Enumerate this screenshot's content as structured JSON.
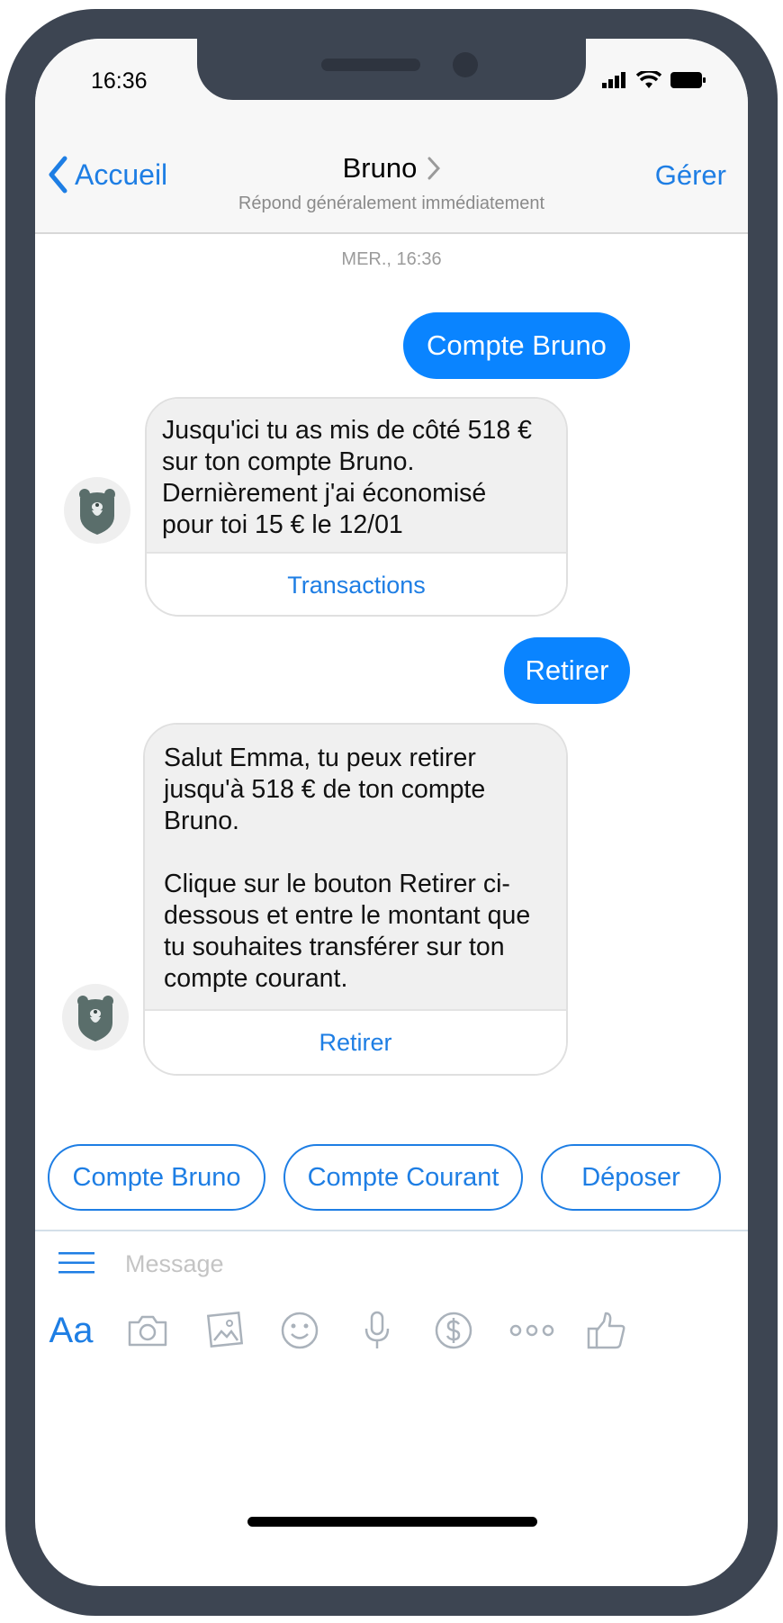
{
  "status": {
    "time": "16:36"
  },
  "nav": {
    "back_label": "Accueil",
    "title": "Bruno",
    "subtitle": "Répond généralement immédiatement",
    "manage_label": "Gérer"
  },
  "conversation": {
    "date": "MER., 16:36",
    "messages": [
      {
        "from": "user",
        "text": "Compte Bruno"
      },
      {
        "from": "bot",
        "text": "Jusqu'ici tu as mis de côté 518 €\nsur ton compte Bruno.\nDernièrement j'ai économisé\npour toi 15 € le 12/01",
        "action": "Transactions"
      },
      {
        "from": "user",
        "text": "Retirer"
      },
      {
        "from": "bot",
        "text": "Salut Emma, tu peux retirer\njusqu'à 518 € de ton compte\nBruno.\n\nClique sur le bouton Retirer ci-\ndessous et entre le montant que\ntu souhaites transférer sur ton\ncompte courant.",
        "action": "Retirer"
      }
    ]
  },
  "quick_replies": [
    "Compte Bruno",
    "Compte Courant",
    "Déposer"
  ],
  "composer": {
    "placeholder": "Message"
  },
  "toolbar": {
    "aa_label": "Aa"
  },
  "colors": {
    "accent": "#1e7ee4",
    "bubble": "#0a84ff",
    "frame": "#3d4552",
    "bot_bubble": "#f0f0f0"
  }
}
